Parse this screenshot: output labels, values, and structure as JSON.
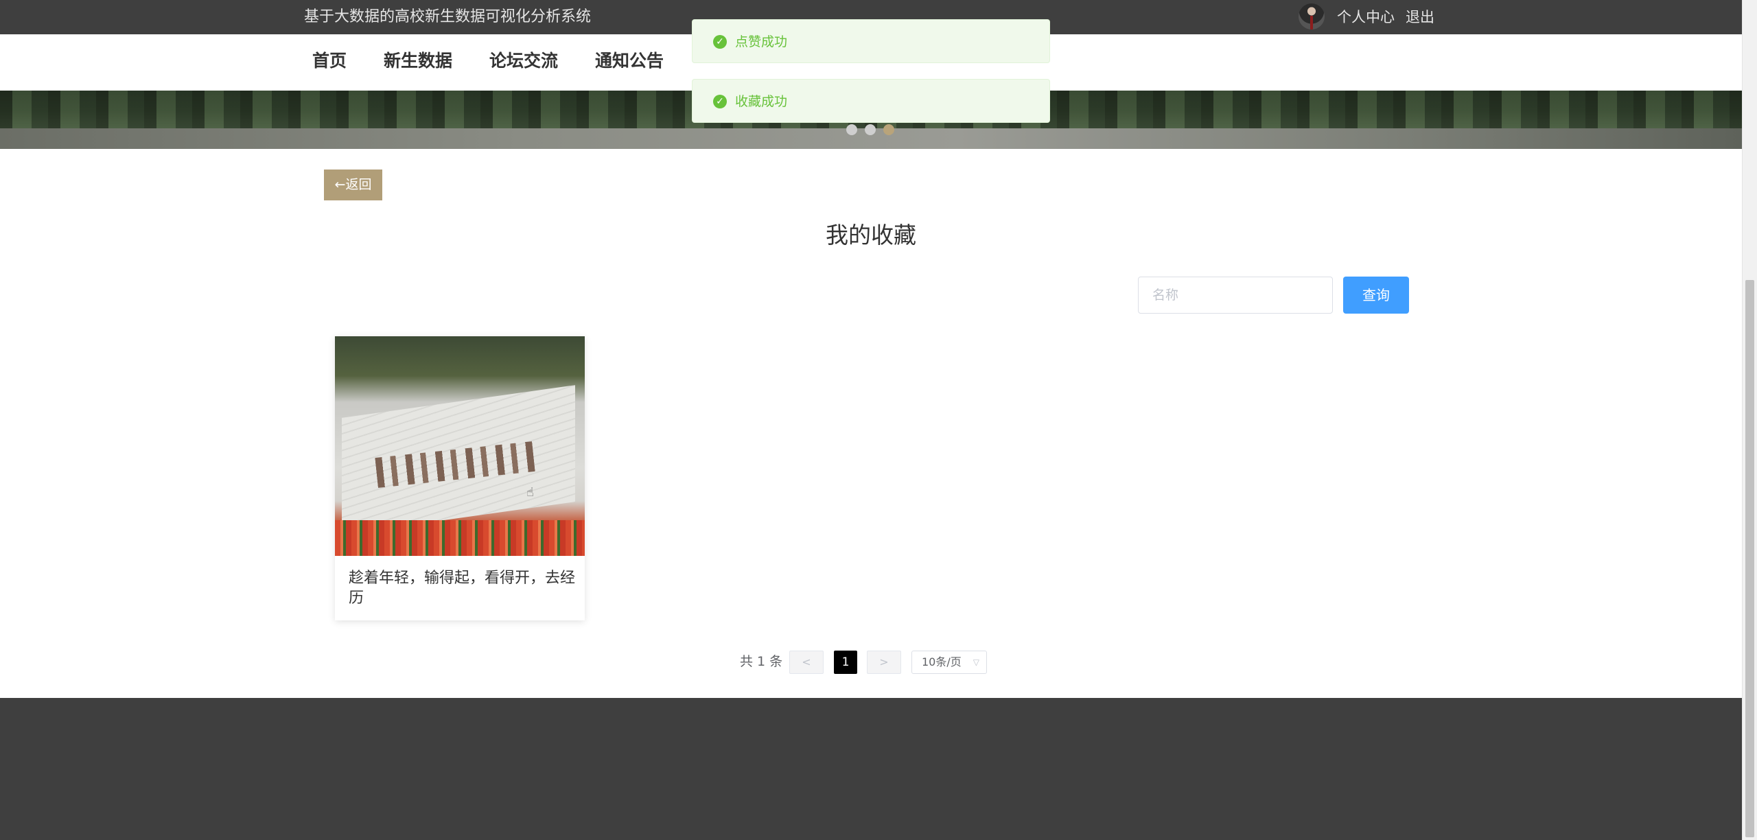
{
  "header": {
    "site_title": "基于大数据的高校新生数据可视化分析系统",
    "user_center": "个人中心",
    "logout": "退出"
  },
  "nav": {
    "items": [
      "首页",
      "新生数据",
      "论坛交流",
      "通知公告"
    ]
  },
  "banner": {
    "slides": 3,
    "active_slide": 3
  },
  "toasts": [
    {
      "type": "success",
      "message": "点赞成功"
    },
    {
      "type": "success",
      "message": "收藏成功"
    }
  ],
  "page": {
    "back_label": "←返回",
    "title": "我的收藏"
  },
  "search": {
    "placeholder": "名称",
    "value": "",
    "button_label": "查询"
  },
  "favorites": [
    {
      "title": "趁着年轻，输得起，看得开，去经历",
      "image": "university-gate-photo"
    }
  ],
  "pagination": {
    "total_label": "共 1 条",
    "prev": "<",
    "next": ">",
    "current_page": "1",
    "page_size": "10条/页"
  },
  "colors": {
    "topbar": "#3f3f3f",
    "accent_brown": "#b19e78",
    "primary_blue": "#409eff",
    "success_green": "#67c23a"
  }
}
